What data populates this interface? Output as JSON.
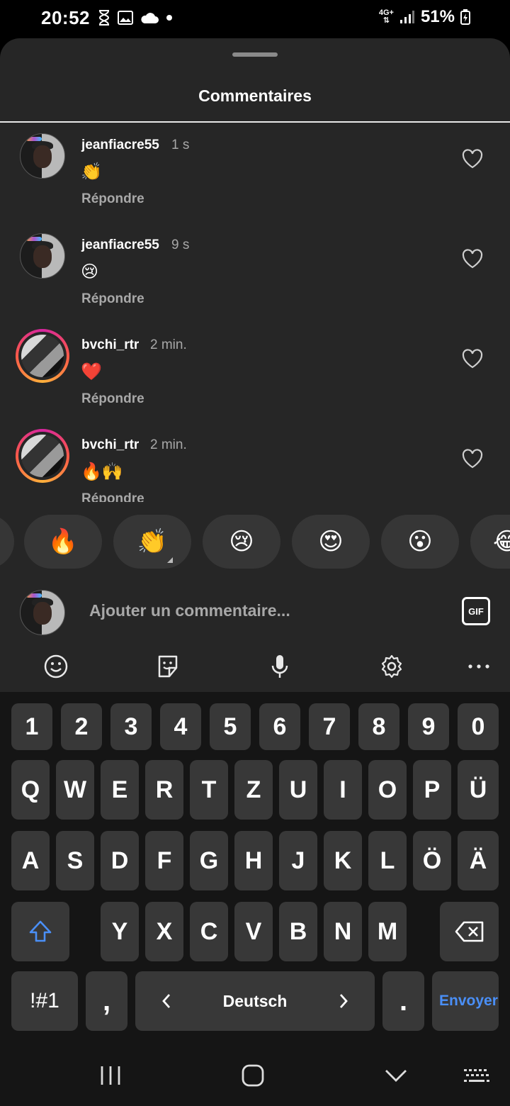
{
  "status_bar": {
    "time": "20:52",
    "network": "4G+",
    "battery": "51%"
  },
  "sheet": {
    "title": "Commentaires"
  },
  "comments": [
    {
      "username": "jeanfiacre55",
      "time": "1 s",
      "text": "👏",
      "reply_label": "Répondre",
      "story_ring": false
    },
    {
      "username": "jeanfiacre55",
      "time": "9 s",
      "text": "😢",
      "reply_label": "Répondre",
      "story_ring": false
    },
    {
      "username": "bvchi_rtr",
      "time": "2 min.",
      "text": "❤️",
      "reply_label": "Répondre",
      "story_ring": true
    },
    {
      "username": "bvchi_rtr",
      "time": "2 min.",
      "text": "🔥🙌",
      "reply_label": "Répondre",
      "story_ring": true
    }
  ],
  "quick_reactions": [
    "🔥",
    "👏",
    "😢",
    "😍",
    "😮",
    "😂"
  ],
  "comment_input": {
    "placeholder": "Ajouter un commentaire...",
    "gif_label": "GIF"
  },
  "keyboard": {
    "toolbar_icons": [
      "emoji-icon",
      "sticker-icon",
      "microphone-icon",
      "settings-icon",
      "more-icon"
    ],
    "row_numbers": [
      "1",
      "2",
      "3",
      "4",
      "5",
      "6",
      "7",
      "8",
      "9",
      "0"
    ],
    "row_top": [
      "Q",
      "W",
      "E",
      "R",
      "T",
      "Z",
      "U",
      "I",
      "O",
      "P",
      "Ü"
    ],
    "row_middle": [
      "A",
      "S",
      "D",
      "F",
      "G",
      "H",
      "J",
      "K",
      "L",
      "Ö",
      "Ä"
    ],
    "row_bottom": [
      "Y",
      "X",
      "C",
      "V",
      "B",
      "N",
      "M"
    ],
    "symbols_label": "!#1",
    "comma_label": ",",
    "space_label": "Deutsch",
    "period_label": ".",
    "send_label": "Envoyer"
  },
  "colors": {
    "sheet_bg": "#262626",
    "key_bg": "#383838",
    "accent_blue": "#4a8ff7",
    "muted_text": "#a8a8a8"
  }
}
